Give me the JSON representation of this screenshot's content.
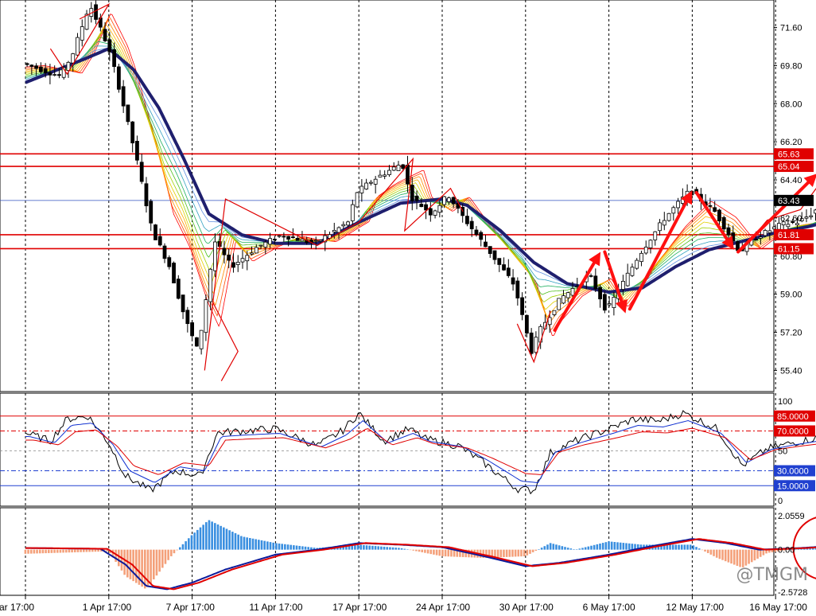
{
  "chart_data": [
    {
      "type": "candlestick",
      "title": "",
      "symbol": "",
      "y_ticks": [
        71.6,
        69.8,
        68.0,
        66.2,
        64.4,
        62.6,
        60.8,
        59.0,
        57.2,
        55.4
      ],
      "ylim": [
        54.4,
        72.9
      ],
      "x_ticks": [
        "ar 17:00",
        "1 Apr 17:00",
        "7 Apr 17:00",
        "11 Apr 17:00",
        "17 Apr 17:00",
        "24 Apr 17:00",
        "30 Apr 17:00",
        "6 May 17:00",
        "12 May 17:00",
        "16 May 17:00"
      ],
      "x_tick_index": [
        0,
        1,
        2,
        3,
        4,
        5,
        6,
        7,
        8,
        9
      ],
      "levels": [
        {
          "label": "65.63",
          "value": 65.63,
          "color": "#e00000"
        },
        {
          "label": "65.04",
          "value": 65.04,
          "color": "#e00000"
        },
        {
          "label": "63.43",
          "value": 63.43,
          "color": "#3050c0"
        },
        {
          "label": "61.81",
          "value": 61.81,
          "color": "#e00000"
        },
        {
          "label": "61.15",
          "value": 61.15,
          "color": "#e00000"
        }
      ],
      "current_price": 63.43,
      "price_path": [
        [
          0,
          69.9
        ],
        [
          0.45,
          69.3
        ],
        [
          0.6,
          70.4
        ],
        [
          0.8,
          72.7
        ],
        [
          1.0,
          70.9
        ],
        [
          1.1,
          69.6
        ],
        [
          1.35,
          65.6
        ],
        [
          1.55,
          62.0
        ],
        [
          1.75,
          60.4
        ],
        [
          1.95,
          57.8
        ],
        [
          2.1,
          56.3
        ],
        [
          2.3,
          61.5
        ],
        [
          2.5,
          60.3
        ],
        [
          2.8,
          61.2
        ],
        [
          3.1,
          61.8
        ],
        [
          3.5,
          61.4
        ],
        [
          3.9,
          62.4
        ],
        [
          4.0,
          63.8
        ],
        [
          4.2,
          64.4
        ],
        [
          4.55,
          65.2
        ],
        [
          4.65,
          63.6
        ],
        [
          4.9,
          62.8
        ],
        [
          5.1,
          63.7
        ],
        [
          5.25,
          62.8
        ],
        [
          5.6,
          61.0
        ],
        [
          5.9,
          59.4
        ],
        [
          6.0,
          57.8
        ],
        [
          6.1,
          56.3
        ],
        [
          6.2,
          57.3
        ],
        [
          6.45,
          58.8
        ],
        [
          6.8,
          59.9
        ],
        [
          7.0,
          58.2
        ],
        [
          7.4,
          60.9
        ],
        [
          7.7,
          62.6
        ],
        [
          8.0,
          63.9
        ],
        [
          8.3,
          62.9
        ],
        [
          8.6,
          61.0
        ],
        [
          8.8,
          61.7
        ],
        [
          9.1,
          62.3
        ],
        [
          9.3,
          62.4
        ],
        [
          9.5,
          62.9
        ],
        [
          9.6,
          63.6
        ]
      ],
      "ribbon_ma": [
        [
          0,
          69.0
        ],
        [
          0.7,
          70.1
        ],
        [
          1.0,
          70.6
        ],
        [
          1.3,
          69.6
        ],
        [
          1.6,
          67.8
        ],
        [
          1.9,
          65.4
        ],
        [
          2.2,
          62.8
        ],
        [
          2.6,
          61.8
        ],
        [
          3.0,
          61.4
        ],
        [
          3.5,
          61.4
        ],
        [
          4.0,
          62.4
        ],
        [
          4.5,
          63.3
        ],
        [
          5.0,
          63.5
        ],
        [
          5.3,
          63.2
        ],
        [
          5.7,
          62.0
        ],
        [
          6.1,
          60.5
        ],
        [
          6.5,
          59.5
        ],
        [
          7.0,
          59.1
        ],
        [
          7.4,
          59.3
        ],
        [
          7.8,
          60.3
        ],
        [
          8.2,
          61.1
        ],
        [
          8.6,
          61.5
        ],
        [
          9.0,
          61.9
        ],
        [
          9.4,
          62.2
        ],
        [
          9.6,
          62.4
        ]
      ],
      "swing_path": [
        [
          2.35,
          54.9
        ],
        [
          2.55,
          56.3
        ],
        [
          2.25,
          58.6
        ],
        [
          2.15,
          55.4
        ],
        [
          2.4,
          63.5
        ],
        [
          3.5,
          61.3
        ],
        [
          3.5,
          61.3
        ],
        [
          4.0,
          62.4
        ],
        [
          4.65,
          65.4
        ],
        [
          4.55,
          62.0
        ],
        [
          5.1,
          64.0
        ],
        [
          5.25,
          62.9
        ]
      ],
      "arrows": [
        {
          "from": [
            6.35,
            57.3
          ],
          "to": [
            6.9,
            61.0
          ]
        },
        {
          "from": [
            6.95,
            61.0
          ],
          "to": [
            7.2,
            58.1
          ]
        },
        {
          "from": [
            7.25,
            58.3
          ],
          "to": [
            8.0,
            63.9
          ]
        },
        {
          "from": [
            8.05,
            63.8
          ],
          "to": [
            8.5,
            61.1
          ]
        },
        {
          "from": [
            8.55,
            61.0
          ],
          "to": [
            9.5,
            64.7
          ]
        },
        {
          "from": [
            9.65,
            64.8
          ],
          "to": [
            9.85,
            62.9
          ]
        }
      ]
    },
    {
      "type": "line",
      "indicator": "stochastic",
      "y_ticks": [
        100,
        50,
        0
      ],
      "ylim": [
        0,
        100
      ],
      "levels": [
        {
          "label": "85.0000",
          "value": 85,
          "color": "#e00000"
        },
        {
          "label": "70.0000",
          "value": 70,
          "color": "#e00000"
        },
        {
          "label": "30.0000",
          "value": 30,
          "color": "#2040d0"
        },
        {
          "label": "15.0000",
          "value": 15,
          "color": "#2040d0"
        }
      ],
      "series_values": [
        [
          0,
          68
        ],
        [
          0.3,
          60
        ],
        [
          0.5,
          82
        ],
        [
          0.75,
          85
        ],
        [
          1.0,
          58
        ],
        [
          1.2,
          25
        ],
        [
          1.5,
          10
        ],
        [
          1.8,
          30
        ],
        [
          2.1,
          25
        ],
        [
          2.3,
          68
        ],
        [
          2.6,
          70
        ],
        [
          3.0,
          72
        ],
        [
          3.5,
          55
        ],
        [
          3.8,
          70
        ],
        [
          4.0,
          88
        ],
        [
          4.3,
          60
        ],
        [
          4.6,
          72
        ],
        [
          4.8,
          62
        ],
        [
          5.2,
          55
        ],
        [
          5.5,
          38
        ],
        [
          5.9,
          12
        ],
        [
          6.1,
          10
        ],
        [
          6.3,
          48
        ],
        [
          6.6,
          60
        ],
        [
          7.0,
          72
        ],
        [
          7.3,
          82
        ],
        [
          7.6,
          80
        ],
        [
          7.9,
          88
        ],
        [
          8.3,
          72
        ],
        [
          8.6,
          35
        ],
        [
          8.9,
          52
        ],
        [
          9.2,
          58
        ],
        [
          9.5,
          63
        ],
        [
          9.6,
          75
        ]
      ]
    },
    {
      "type": "bar",
      "indicator": "macd",
      "y_ticks": [
        2.0559,
        0.0,
        -2.5728
      ],
      "ylim": [
        -2.5728,
        2.0559
      ],
      "hist_anchors": [
        [
          0,
          -0.25
        ],
        [
          1.0,
          -0.1
        ],
        [
          1.2,
          -1.6
        ],
        [
          1.45,
          -2.4
        ],
        [
          1.75,
          -0.4
        ],
        [
          2.0,
          0.9
        ],
        [
          2.2,
          1.8
        ],
        [
          2.6,
          0.8
        ],
        [
          3.0,
          0.4
        ],
        [
          3.5,
          0.1
        ],
        [
          4.0,
          0.3
        ],
        [
          4.5,
          0.1
        ],
        [
          5.0,
          -0.4
        ],
        [
          5.5,
          -0.5
        ],
        [
          6.0,
          -0.4
        ],
        [
          6.3,
          0.4
        ],
        [
          6.6,
          0.0
        ],
        [
          7.0,
          0.5
        ],
        [
          7.4,
          0.3
        ],
        [
          8.0,
          0.3
        ],
        [
          8.3,
          -0.5
        ],
        [
          8.6,
          -1.1
        ],
        [
          8.9,
          -0.2
        ],
        [
          9.3,
          0.1
        ],
        [
          9.6,
          0.15
        ]
      ],
      "line_values": [
        [
          0,
          0.1
        ],
        [
          0.9,
          0.05
        ],
        [
          1.2,
          -0.9
        ],
        [
          1.45,
          -2.2
        ],
        [
          1.7,
          -2.4
        ],
        [
          2.0,
          -2.0
        ],
        [
          2.4,
          -1.2
        ],
        [
          3.0,
          -0.3
        ],
        [
          3.5,
          0.0
        ],
        [
          4.0,
          0.4
        ],
        [
          4.5,
          0.3
        ],
        [
          5.0,
          0.15
        ],
        [
          5.5,
          -0.4
        ],
        [
          6.0,
          -1.0
        ],
        [
          6.4,
          -0.8
        ],
        [
          7.0,
          -0.3
        ],
        [
          7.5,
          0.2
        ],
        [
          8.0,
          0.65
        ],
        [
          8.4,
          0.4
        ],
        [
          8.8,
          0.0
        ],
        [
          9.3,
          0.1
        ],
        [
          9.6,
          0.2
        ]
      ],
      "highlight_circle": {
        "center": [
          9.5,
          0.1
        ]
      }
    }
  ],
  "watermark": "@TMGM"
}
